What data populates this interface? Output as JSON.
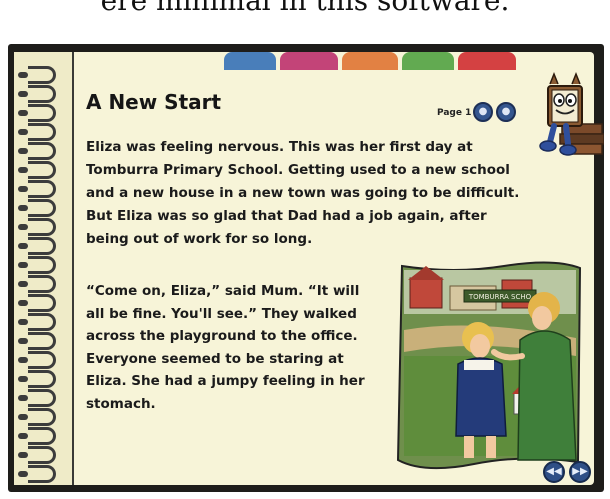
{
  "top_caption": "ere minimal in this software.",
  "tabs": [
    {
      "label": "",
      "color": "#3f77b8"
    },
    {
      "label": "",
      "color": "#c03a73"
    },
    {
      "label": "",
      "color": "#e07a3b"
    },
    {
      "label": "",
      "color": "#5aa54a"
    },
    {
      "label": "",
      "color": "#d2373a"
    }
  ],
  "book": {
    "title": "A New Start",
    "page_label": "Page 1",
    "paragraph1": "Eliza was feeling nervous.  This was her first day at Tomburra Primary School.  Getting used to a new school and a new house in a new town was going to be difficult.  But Eliza was so glad that Dad had a job again, after being out of work for so long.",
    "paragraph2": "“Come on, Eliza,” said Mum.  “It will all be fine.  You'll see.”  They walked across the playground to the office.  Everyone seemed to be staring at Eliza.  She had a jumpy feeling in her stomach."
  },
  "colors": {
    "page": "#f7f4d8",
    "frame": "#1e1d1a",
    "nav_button": "#35568f"
  },
  "icons": {
    "mascot": "book-character-icon",
    "page_prev": "prev-page-icon",
    "page_next": "next-page-icon",
    "nav_prev": "rewind-icon",
    "nav_next": "forward-icon"
  },
  "illustration": {
    "sign_text": "TOMBURRA SCHO"
  }
}
